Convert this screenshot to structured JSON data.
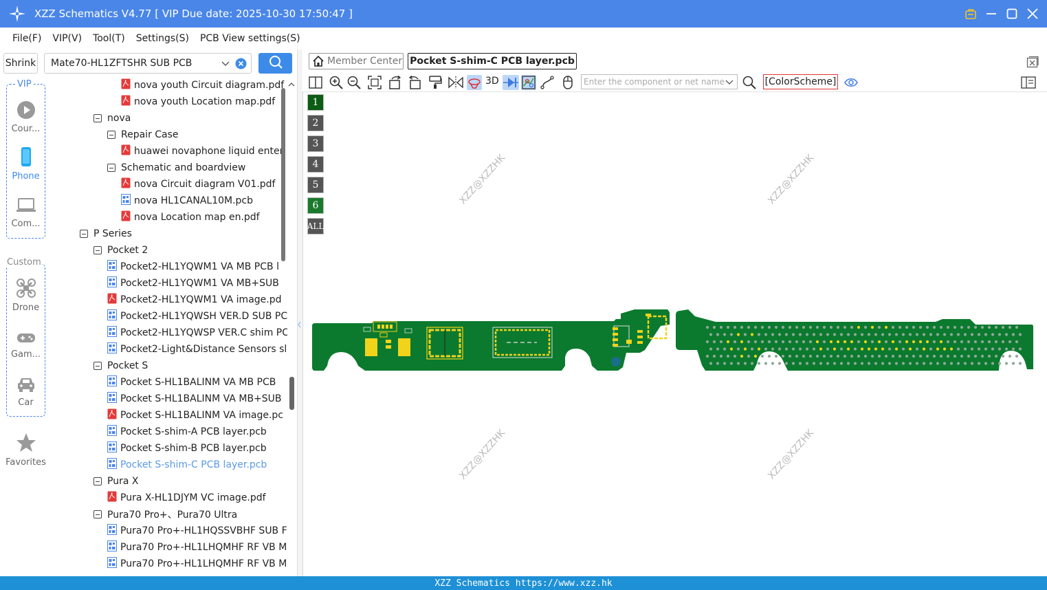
{
  "window": {
    "title": "XZZ Schematics V4.77 [ VIP Due date: 2025-10-30 17:50:47 ]"
  },
  "menu": [
    "File(F)",
    "VIP(V)",
    "Tool(T)",
    "Settings(S)",
    "PCB View settings(S)"
  ],
  "left_top": {
    "shrink_label": "Shrink",
    "pcb_select_value": "Mate70-HL1ZFTSHR SUB PCB"
  },
  "sidebar": {
    "vip_label": "VIP",
    "custom_label": "Custom",
    "items": [
      {
        "label": "Cour...",
        "icon": "play-circle-icon"
      },
      {
        "label": "Phone",
        "icon": "phone-icon"
      },
      {
        "label": "Com...",
        "icon": "laptop-icon"
      },
      {
        "label": "Drone",
        "icon": "drone-icon"
      },
      {
        "label": "Gam...",
        "icon": "gamepad-icon"
      },
      {
        "label": "Car",
        "icon": "car-icon"
      },
      {
        "label": "Favorites",
        "icon": "star-icon"
      }
    ]
  },
  "tree": [
    {
      "label": "nova youth Circuit diagram.pdf",
      "type": "pdf",
      "level": 3
    },
    {
      "label": "nova youth Location map.pdf",
      "type": "pdf",
      "level": 3
    },
    {
      "label": "nova",
      "type": "folder",
      "level": 1
    },
    {
      "label": "Repair Case",
      "type": "folder",
      "level": 2
    },
    {
      "label": "huawei novaphone liquid enter",
      "type": "pdf",
      "level": 3
    },
    {
      "label": "Schematic and boardview",
      "type": "folder",
      "level": 2
    },
    {
      "label": "nova Circuit diagram V01.pdf",
      "type": "pdf",
      "level": 3
    },
    {
      "label": "nova HL1CANAL10M.pcb",
      "type": "pcb",
      "level": 3
    },
    {
      "label": "nova Location map en.pdf",
      "type": "pdf",
      "level": 3
    },
    {
      "label": "P Series",
      "type": "folder",
      "level": 0
    },
    {
      "label": "Pocket 2",
      "type": "folder",
      "level": 1
    },
    {
      "label": "Pocket2-HL1YQWM1 VA MB PCB l",
      "type": "pcb",
      "level": 2
    },
    {
      "label": "Pocket2-HL1YQWM1 VA MB+SUB",
      "type": "pcb",
      "level": 2
    },
    {
      "label": "Pocket2-HL1YQWM1 VA image.pd",
      "type": "pdf",
      "level": 2
    },
    {
      "label": "Pocket2-HL1YQWSH VER.D SUB PC",
      "type": "pcb",
      "level": 2
    },
    {
      "label": "Pocket2-HL1YQWSP VER.C shim PC",
      "type": "pcb",
      "level": 2
    },
    {
      "label": "Pocket2-Light&Distance Sensors sl",
      "type": "pcb",
      "level": 2
    },
    {
      "label": "Pocket S",
      "type": "folder",
      "level": 1
    },
    {
      "label": "Pocket S-HL1BALINM VA MB PCB",
      "type": "pcb",
      "level": 2
    },
    {
      "label": "Pocket S-HL1BALINM VA MB+SUB",
      "type": "pcb",
      "level": 2
    },
    {
      "label": "Pocket S-HL1BALINM VA image.pc",
      "type": "pdf",
      "level": 2
    },
    {
      "label": "Pocket S-shim-A PCB layer.pcb",
      "type": "pcb",
      "level": 2
    },
    {
      "label": "Pocket S-shim-B PCB layer.pcb",
      "type": "pcb",
      "level": 2
    },
    {
      "label": "Pocket S-shim-C PCB layer.pcb",
      "type": "pcb",
      "level": 2,
      "selected": true
    },
    {
      "label": "Pura X",
      "type": "folder",
      "level": 1
    },
    {
      "label": "Pura X-HL1DJYM VC image.pdf",
      "type": "pdf",
      "level": 2
    },
    {
      "label": "Pura70 Pro+、Pura70 Ultra",
      "type": "folder",
      "level": 1
    },
    {
      "label": "Pura70 Pro+-HL1HQSSVBHF SUB F",
      "type": "pcb",
      "level": 2
    },
    {
      "label": "Pura70 Pro+-HL1LHQMHF RF VB M",
      "type": "pcb",
      "level": 2
    },
    {
      "label": "Pura70 Pro+-HL1LHQMHF RF VB M",
      "type": "pcb",
      "level": 2
    }
  ],
  "tabs": {
    "member_center": "Member Center",
    "active": "Pocket S-shim-C PCB layer.pcb"
  },
  "toolbar": {
    "three_d": "3D",
    "component_search_placeholder": "Enter the component or net name",
    "color_scheme": "[ColorScheme]"
  },
  "layers": [
    {
      "label": "1",
      "color": "#0d5c14"
    },
    {
      "label": "2",
      "color": "#555555"
    },
    {
      "label": "3",
      "color": "#555555"
    },
    {
      "label": "4",
      "color": "#555555"
    },
    {
      "label": "5",
      "color": "#555555"
    },
    {
      "label": "6",
      "color": "#1a7a2c"
    },
    {
      "label": "ALL",
      "color": "#555555"
    }
  ],
  "watermark": "XZZ@XZZHK",
  "status": "XZZ Schematics https://www.xzz.hk",
  "colors": {
    "accent": "#4a86e8",
    "pcb_green": "#0b7a2e",
    "pad_yellow": "#f2d31b",
    "status_bar": "#1e90d6"
  }
}
